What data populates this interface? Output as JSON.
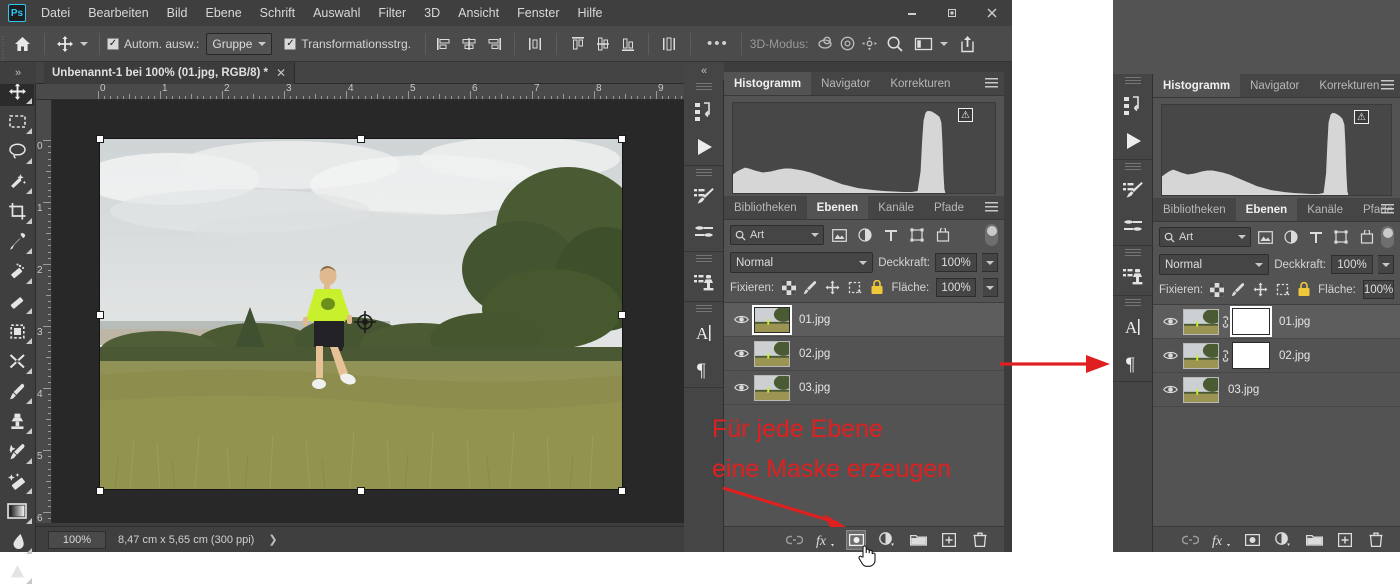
{
  "window": {
    "app_logo": "Ps",
    "controls": {
      "minimize": "—",
      "maximize": "❐",
      "close": "✕"
    }
  },
  "menubar": {
    "items": [
      "Datei",
      "Bearbeiten",
      "Bild",
      "Ebene",
      "Schrift",
      "Auswahl",
      "Filter",
      "3D",
      "Ansicht",
      "Fenster",
      "Hilfe"
    ]
  },
  "options_bar": {
    "home_icon": "home-icon",
    "tool_icon": "move-tool-icon",
    "auto_select_checked": "✓",
    "auto_select_label": "Autom. ausw.:",
    "auto_select_value": "Gruppe",
    "transform_controls_checked": "✓",
    "transform_controls_label": "Transformationsstrg.",
    "more_label": "•••",
    "mode3d_label": "3D-Modus:",
    "align_icons": [
      "align-left-icon",
      "align-center-h-icon",
      "align-right-icon",
      "distribute-icon"
    ],
    "align_icons2": [
      "align-top-icon",
      "align-middle-icon",
      "align-bottom-icon",
      "distribute-v-icon"
    ],
    "right_icons": [
      "3d-orbit-icon",
      "3d-roll-icon",
      "3d-pan-icon",
      "search-icon",
      "workspace-icon",
      "share-icon"
    ]
  },
  "toolbar": {
    "tools": [
      {
        "name": "move-tool",
        "glyph": "move",
        "active": true
      },
      {
        "name": "rectangular-marquee-tool",
        "glyph": "marquee",
        "active": false
      },
      {
        "name": "lasso-tool",
        "glyph": "lasso",
        "active": false
      },
      {
        "name": "quick-selection-tool",
        "glyph": "wand",
        "active": false
      },
      {
        "name": "crop-tool",
        "glyph": "crop",
        "active": false
      },
      {
        "name": "eyedropper-tool",
        "glyph": "eyedropper",
        "active": false
      },
      {
        "name": "spot-healing-brush-tool",
        "glyph": "heal",
        "active": false
      },
      {
        "name": "patch-tool",
        "glyph": "patch",
        "active": false
      },
      {
        "name": "frame-tool",
        "glyph": "frame",
        "active": false
      },
      {
        "name": "clone-source-tool",
        "glyph": "scissorsx",
        "active": false
      },
      {
        "name": "brush-tool",
        "glyph": "brush",
        "active": false
      },
      {
        "name": "clone-stamp-tool",
        "glyph": "stamp",
        "active": false
      },
      {
        "name": "history-brush-tool",
        "glyph": "historybrush",
        "active": false
      },
      {
        "name": "eraser-tool",
        "glyph": "eraser",
        "active": false
      },
      {
        "name": "gradient-tool",
        "glyph": "gradient",
        "active": false
      },
      {
        "name": "blur-tool",
        "glyph": "blur",
        "active": false
      },
      {
        "name": "dodge-tool",
        "glyph": "dodge",
        "active": false
      }
    ]
  },
  "document": {
    "tab_title": "Unbenannt-1 bei 100% (01.jpg, RGB/8) *",
    "close_glyph": "✕",
    "collapse_glyph": "»",
    "ruler_h_labels": [
      "0",
      "1",
      "2",
      "3",
      "4",
      "5",
      "6",
      "7",
      "8",
      "9"
    ],
    "ruler_v_labels": [
      "0",
      "1",
      "2",
      "3",
      "4",
      "5",
      "6"
    ],
    "canvas_collapse": "«"
  },
  "status_bar": {
    "zoom": "100%",
    "doc_size": "8,47 cm x 5,65 cm (300 ppi)",
    "expand_glyph": "❯"
  },
  "icon_strip": {
    "collapse_glyph": "«",
    "groups": [
      [
        "history-icon",
        "actions-play-icon"
      ],
      [
        "brushes-icon",
        "brush-settings-icon"
      ],
      [
        "clone-source-icon"
      ],
      [
        "character-icon",
        "paragraph-icon"
      ]
    ]
  },
  "panel_left": {
    "top_tabs": [
      {
        "label": "Histogramm",
        "active": true
      },
      {
        "label": "Navigator",
        "active": false
      },
      {
        "label": "Korrekturen",
        "active": false
      }
    ],
    "menu_icon": "panel-menu-icon",
    "histogram_warning": "⚠",
    "layer_tabs": [
      {
        "label": "Bibliotheken",
        "active": false
      },
      {
        "label": "Ebenen",
        "active": true
      },
      {
        "label": "Kanäle",
        "active": false
      },
      {
        "label": "Pfade",
        "active": false
      }
    ],
    "filter_placeholder": "Art",
    "filter_icons": [
      "filter-image-icon",
      "filter-adjustment-icon",
      "filter-type-icon",
      "filter-shape-icon",
      "filter-smartobject-icon"
    ],
    "blend_mode": "Normal",
    "opacity_label": "Deckkraft:",
    "opacity_value": "100%",
    "lock_label": "Fixieren:",
    "lock_icons": [
      "lock-transparency-icon",
      "lock-image-icon",
      "lock-position-icon",
      "lock-artboard-icon",
      "lock-all-icon"
    ],
    "fill_label": "Fläche:",
    "fill_value": "100%",
    "layers": [
      {
        "name": "01.jpg",
        "visible": true,
        "selected": true,
        "has_mask": false,
        "thumb_framed": true
      },
      {
        "name": "02.jpg",
        "visible": true,
        "selected": false,
        "has_mask": false,
        "thumb_framed": false
      },
      {
        "name": "03.jpg",
        "visible": true,
        "selected": false,
        "has_mask": false,
        "thumb_framed": false
      }
    ],
    "bottom_buttons": [
      {
        "name": "link-layers-button",
        "glyph": "link",
        "active": false
      },
      {
        "name": "layer-style-button",
        "glyph": "fx",
        "active": false
      },
      {
        "name": "add-layer-mask-button",
        "glyph": "mask",
        "active": true
      },
      {
        "name": "new-adjustment-layer-button",
        "glyph": "adjust",
        "active": false
      },
      {
        "name": "new-group-button",
        "glyph": "folder",
        "active": false
      },
      {
        "name": "new-layer-button",
        "glyph": "newlayer",
        "active": false
      },
      {
        "name": "delete-layer-button",
        "glyph": "trash",
        "active": false
      }
    ]
  },
  "panel_right": {
    "top_tabs": [
      {
        "label": "Histogramm",
        "active": true
      },
      {
        "label": "Navigator",
        "active": false
      },
      {
        "label": "Korrekturen",
        "active": false
      }
    ],
    "histogram_warning": "⚠",
    "layer_tabs": [
      {
        "label": "Bibliotheken",
        "active": false
      },
      {
        "label": "Ebenen",
        "active": true
      },
      {
        "label": "Kanäle",
        "active": false
      },
      {
        "label": "Pfade",
        "active": false
      }
    ],
    "filter_placeholder": "Art",
    "blend_mode": "Normal",
    "opacity_label": "Deckkraft:",
    "opacity_value": "100%",
    "lock_label": "Fixieren:",
    "fill_label": "Fläche:",
    "fill_value": "100%",
    "layers": [
      {
        "name": "01.jpg",
        "visible": true,
        "selected": true,
        "has_mask": true,
        "mask_framed": true
      },
      {
        "name": "02.jpg",
        "visible": true,
        "selected": false,
        "has_mask": true,
        "mask_framed": false
      },
      {
        "name": "03.jpg",
        "visible": true,
        "selected": false,
        "has_mask": false,
        "mask_framed": false
      }
    ],
    "bottom_buttons": [
      {
        "name": "link-layers-button",
        "glyph": "link"
      },
      {
        "name": "layer-style-button",
        "glyph": "fx"
      },
      {
        "name": "add-layer-mask-button",
        "glyph": "mask"
      },
      {
        "name": "new-adjustment-layer-button",
        "glyph": "adjust"
      },
      {
        "name": "new-group-button",
        "glyph": "folder"
      },
      {
        "name": "new-layer-button",
        "glyph": "newlayer"
      },
      {
        "name": "delete-layer-button",
        "glyph": "trash"
      }
    ]
  },
  "annotations": {
    "line1": "Für jede Ebene",
    "line2": "eine Maske erzeugen",
    "color": "#e02020",
    "arrow_to_mask_button": "arrow-down-right",
    "arrow_between_panels": "arrow-right"
  }
}
